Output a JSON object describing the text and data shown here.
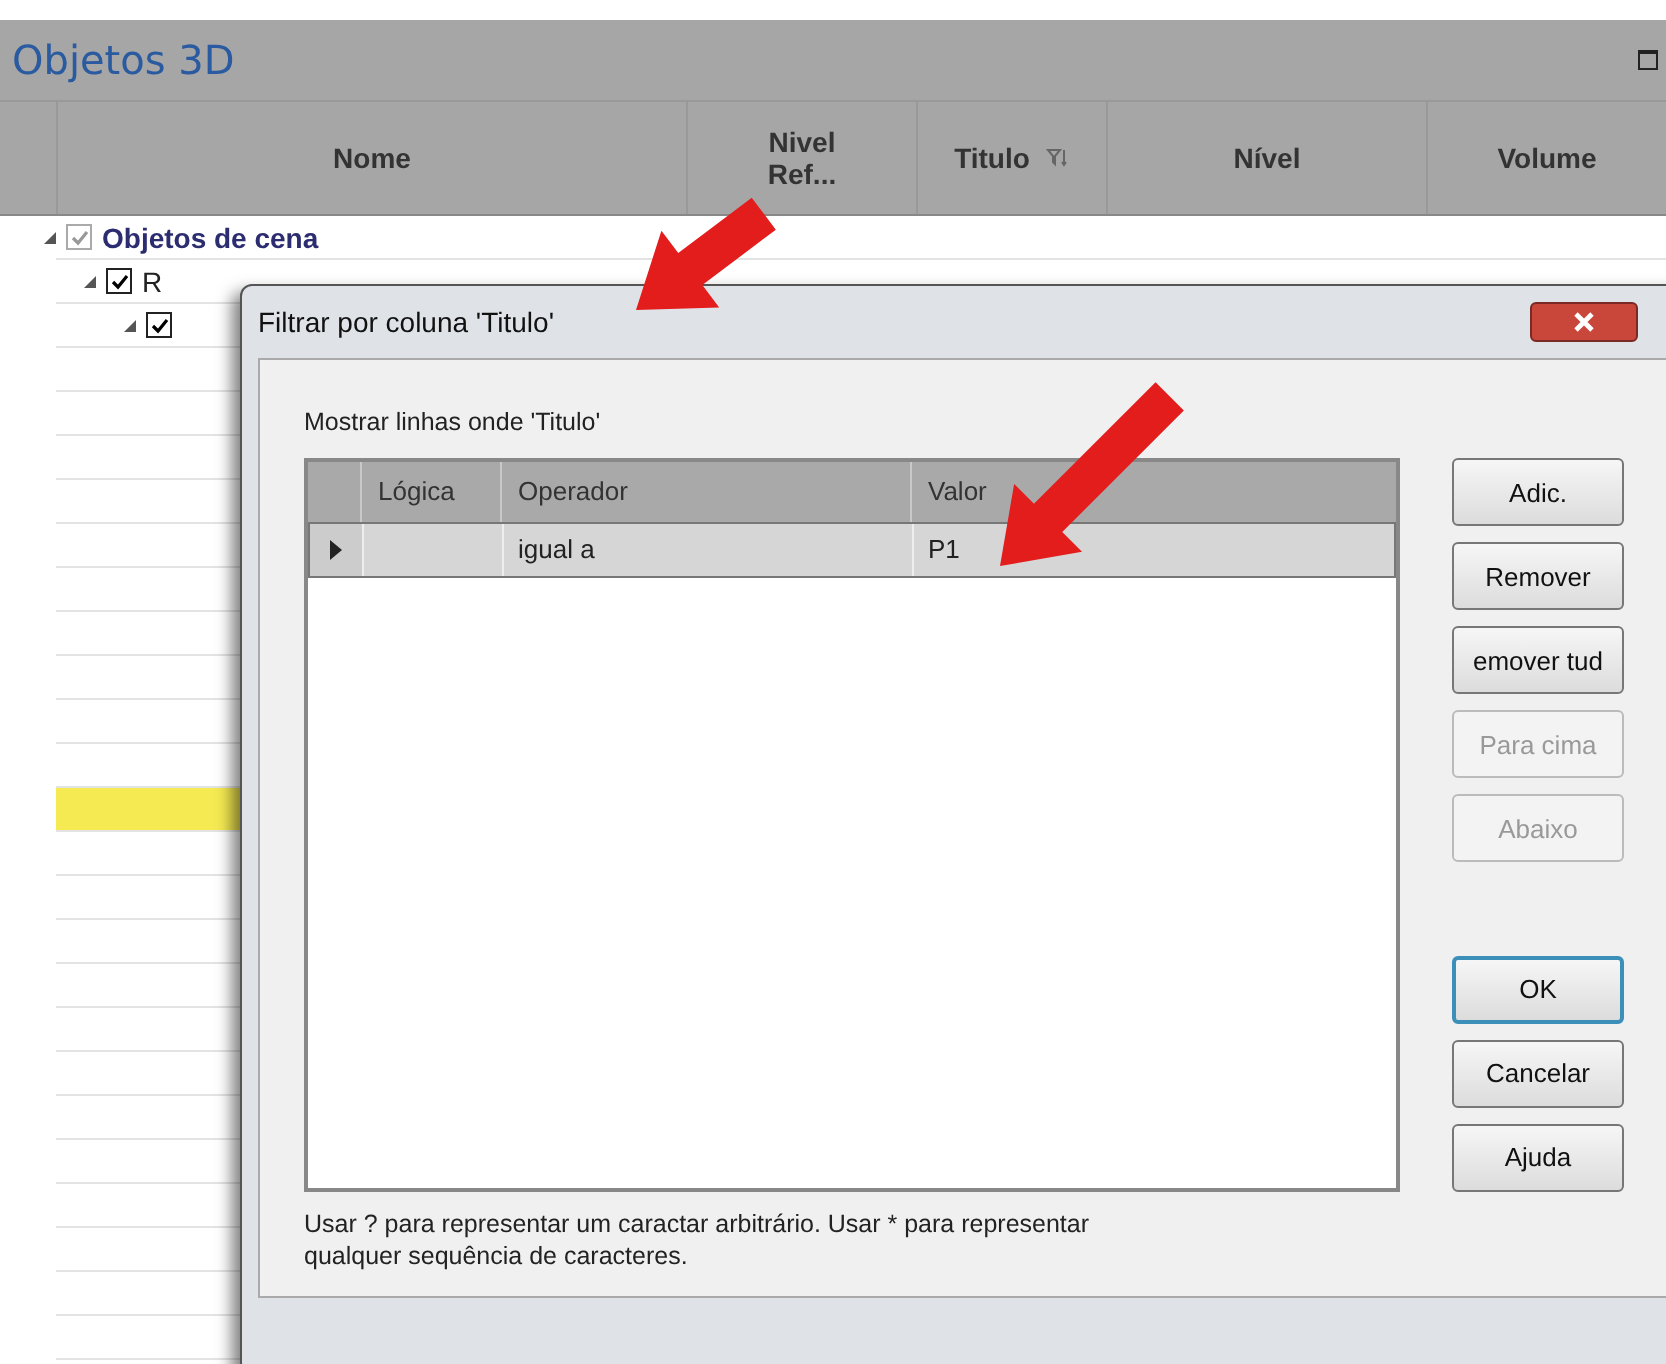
{
  "panel": {
    "title": "Objetos 3D"
  },
  "table": {
    "columns": [
      {
        "label": "Nome"
      },
      {
        "label": "Nivel Ref..."
      },
      {
        "label": "Titulo",
        "filtered": true
      },
      {
        "label": "Nível"
      },
      {
        "label": "Volume"
      }
    ],
    "rows": [
      {
        "label": "Objetos de cena",
        "checked": true,
        "partial": true,
        "expanded": true,
        "children": [
          {
            "label": "R",
            "checked": true,
            "partial": false,
            "expanded": true,
            "children": [
              {
                "checked": true,
                "partial": false,
                "expanded": true
              }
            ]
          }
        ]
      }
    ],
    "blank_rows": [
      {
        "highlighted": false
      },
      {
        "highlighted": false
      },
      {
        "highlighted": false
      },
      {
        "highlighted": false
      },
      {
        "highlighted": false
      },
      {
        "highlighted": false
      },
      {
        "highlighted": false
      },
      {
        "highlighted": false
      },
      {
        "highlighted": false
      },
      {
        "highlighted": false
      },
      {
        "highlighted": true
      },
      {
        "highlighted": false
      },
      {
        "highlighted": false
      },
      {
        "highlighted": false
      },
      {
        "highlighted": false
      },
      {
        "highlighted": false
      },
      {
        "highlighted": false
      },
      {
        "highlighted": false
      },
      {
        "highlighted": false
      },
      {
        "highlighted": false
      },
      {
        "highlighted": false
      },
      {
        "highlighted": false
      },
      {
        "highlighted": false
      }
    ]
  },
  "dialog": {
    "title": "Filtrar por coluna 'Titulo'",
    "prompt": "Mostrar linhas onde 'Titulo'",
    "grid": {
      "columns": [
        "Lógica",
        "Operador",
        "Valor"
      ],
      "rows": [
        {
          "selected": true,
          "cells": [
            "",
            "igual a",
            "P1"
          ]
        }
      ]
    },
    "buttons": [
      {
        "label": "Adic.",
        "disabled": false,
        "default": false
      },
      {
        "label": "Remover",
        "disabled": false,
        "default": false
      },
      {
        "label": "emover tud",
        "disabled": false,
        "default": false
      },
      {
        "label": "Para cima",
        "disabled": true,
        "default": false
      },
      {
        "label": "Abaixo",
        "disabled": true,
        "default": false
      },
      {
        "label": "OK",
        "disabled": false,
        "default": true
      },
      {
        "label": "Cancelar",
        "disabled": false,
        "default": false
      },
      {
        "label": "Ajuda",
        "disabled": false,
        "default": false
      }
    ],
    "hint": "Usar ? para representar um caractar arbitrário. Usar * para representar qualquer sequência de caracteres."
  },
  "annotations": [
    {
      "kind": "arrow"
    },
    {
      "kind": "arrow"
    }
  ]
}
